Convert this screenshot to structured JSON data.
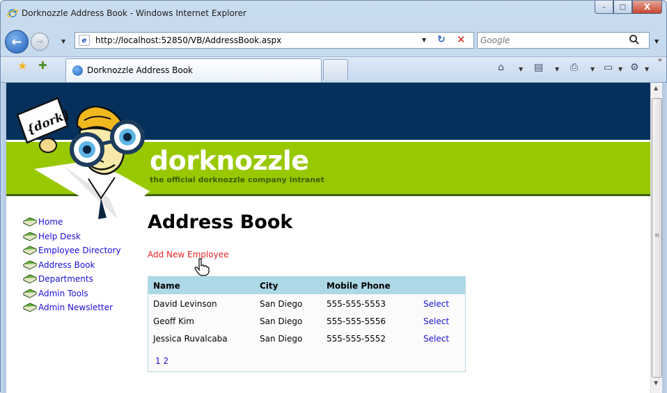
{
  "window": {
    "title": "Dorknozzle Address Book - Windows Internet Explorer",
    "controls": {
      "minimize": "–",
      "maximize": "□",
      "close": "X"
    }
  },
  "address_bar": {
    "url": "http://localhost:52850/VB/AddressBook.aspx",
    "search_placeholder": "Google"
  },
  "tabs": [
    {
      "label": "Dorknozzle Address Book",
      "active": true
    }
  ],
  "site": {
    "logo_sign": "{dork}",
    "brand": "dorknozzle",
    "tagline": "the official dorknozzle company intranet",
    "colors": {
      "navy": "#06305c",
      "green": "#98c800",
      "link": "#1a0fdb",
      "add_link": "#e32222",
      "grid_header": "#add8e6"
    }
  },
  "sidebar": {
    "items": [
      {
        "label": "Home",
        "icon": "book-icon"
      },
      {
        "label": "Help Desk",
        "icon": "book-icon"
      },
      {
        "label": "Employee Directory",
        "icon": "book-icon"
      },
      {
        "label": "Address Book",
        "icon": "book-icon"
      },
      {
        "label": "Departments",
        "icon": "book-icon"
      },
      {
        "label": "Admin Tools",
        "icon": "book-icon"
      },
      {
        "label": "Admin Newsletter",
        "icon": "book-icon"
      }
    ]
  },
  "main": {
    "title": "Address Book",
    "add_link": "Add New Employee",
    "grid": {
      "columns": [
        "Name",
        "City",
        "Mobile Phone"
      ],
      "rows": [
        {
          "name": "David Levinson",
          "city": "San Diego",
          "phone": "555-555-5553",
          "action": "Select"
        },
        {
          "name": "Geoff Kim",
          "city": "San Diego",
          "phone": "555-555-5556",
          "action": "Select"
        },
        {
          "name": "Jessica Ruvalcaba",
          "city": "San Diego",
          "phone": "555-555-5552",
          "action": "Select"
        }
      ],
      "pages": [
        "1",
        "2"
      ]
    }
  }
}
